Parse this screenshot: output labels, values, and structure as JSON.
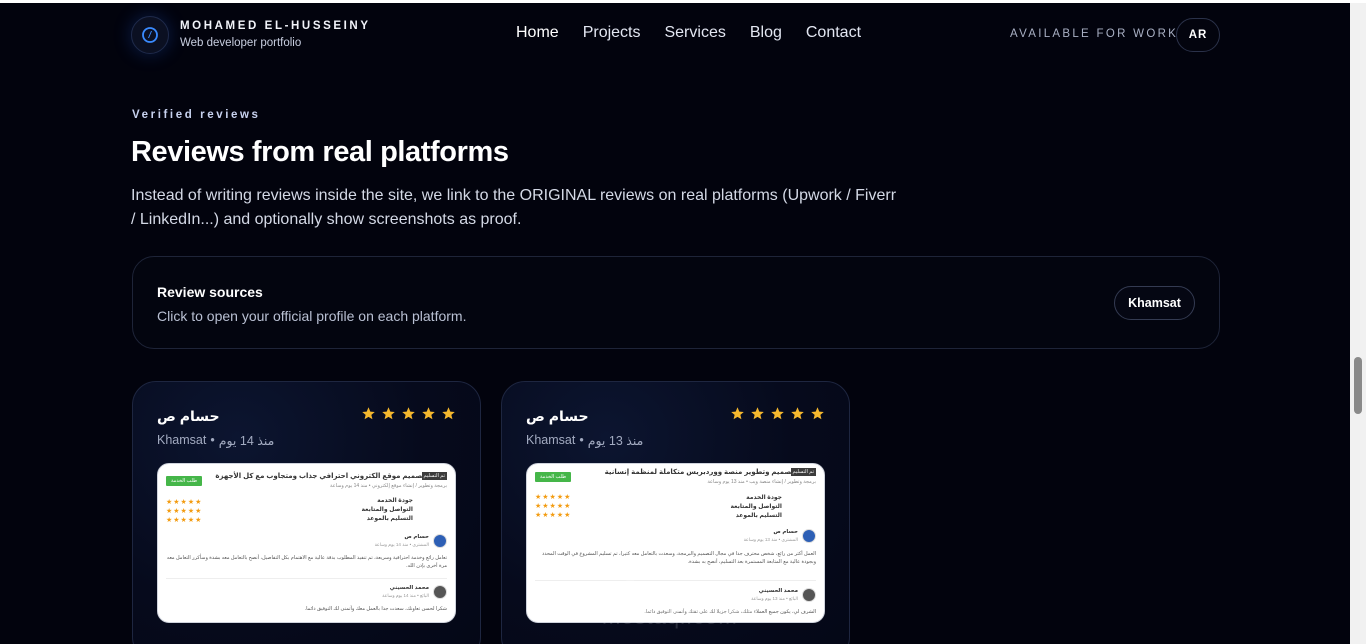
{
  "header": {
    "brand_name": "MOHAMED EL-HUSSEINY",
    "brand_sub": "Web developer portfolio",
    "nav": [
      {
        "label": "Home"
      },
      {
        "label": "Projects"
      },
      {
        "label": "Services"
      },
      {
        "label": "Blog"
      },
      {
        "label": "Contact"
      }
    ],
    "availability": "AVAILABLE FOR WORK",
    "lang_button": "AR"
  },
  "section": {
    "eyebrow": "Verified reviews",
    "title": "Reviews from real platforms",
    "lead": "Instead of writing reviews inside the site, we link to the ORIGINAL reviews on real platforms (Upwork / Fiverr / LinkedIn...) and optionally show screenshots as proof."
  },
  "sources": {
    "title": "Review sources",
    "subtitle": "Click to open your official profile on each platform.",
    "platforms": [
      {
        "label": "Khamsat"
      }
    ]
  },
  "reviews": [
    {
      "name": "حسام ص",
      "rating": 5,
      "platform": "Khamsat",
      "separator": "•",
      "time": "منذ 14 يوم",
      "screenshot": {
        "title": "تصميم موقع الكتروني احترافي جذاب ومتجاوب مع كل الأجهزة",
        "tag": "تم التسليم",
        "button": "طلب الخدمة",
        "meta": "برمجة وتطوير / إنشاء موقع إلكتروني  •  منذ 14 يوم وساعة",
        "categories": [
          "جودة الخدمة",
          "التواصل والمتابعة",
          "التسليم بالموعد"
        ],
        "reviewer": "حسام ص",
        "reviewer_meta": "المشتري  •  منذ 14 يوم وساعة",
        "review_text": "تعامل رائع وخدمة احترافية وسريعة، تم تنفيذ المطلوب بدقة عالية مع الاهتمام بكل التفاصيل، أنصح بالتعامل معه بشدة وسأكرر التعامل معه مرة أخرى بإذن الله.",
        "seller": "محمد الحسيني",
        "seller_meta": "البائع  •  منذ 14 يوم وساعة",
        "seller_reply": "شكرا لحسن تعاونك، سعدت جدا بالعمل معك وأتمنى لك التوفيق دائما."
      }
    },
    {
      "name": "حسام ص",
      "rating": 5,
      "platform": "Khamsat",
      "separator": "•",
      "time": "منذ 13 يوم",
      "screenshot": {
        "title": "تصميم وتطوير منصة ووردبريس متكاملة لمنظمة إنسانية",
        "tag": "تم التسليم",
        "button": "طلب الخدمة",
        "meta": "برمجة وتطوير / إنشاء منصة ويب  •  منذ 13 يوم وساعة",
        "categories": [
          "جودة الخدمة",
          "التواصل والمتابعة",
          "التسليم بالموعد"
        ],
        "reviewer": "حسام ص",
        "reviewer_meta": "المشتري  •  منذ 13 يوم وساعة",
        "review_text": "العمل أكثر من رائع، شخص محترف جدا في مجال التصميم والبرمجة، وسعدت بالتعامل معه كثيرا، تم تسليم المشروع في الوقت المحدد وبجودة عالية مع المتابعة المستمرة بعد التسليم، أنصح به بشدة.",
        "seller": "محمد الحسيني",
        "seller_meta": "البائع  •  منذ 13 يوم وساعة",
        "seller_reply": "الشرف لي، يكون جميع العملاء مثلك، شكرا جزيلا لك على ثقتك وأتمنى التوفيق دائما."
      }
    }
  ],
  "watermark": {
    "main": "مستقل",
    "sub": "mostaql.com"
  },
  "colors": {
    "background": "#02030d",
    "star": "#f5b82e",
    "accent": "#3a7bff",
    "khamsat_green": "#45b649"
  }
}
